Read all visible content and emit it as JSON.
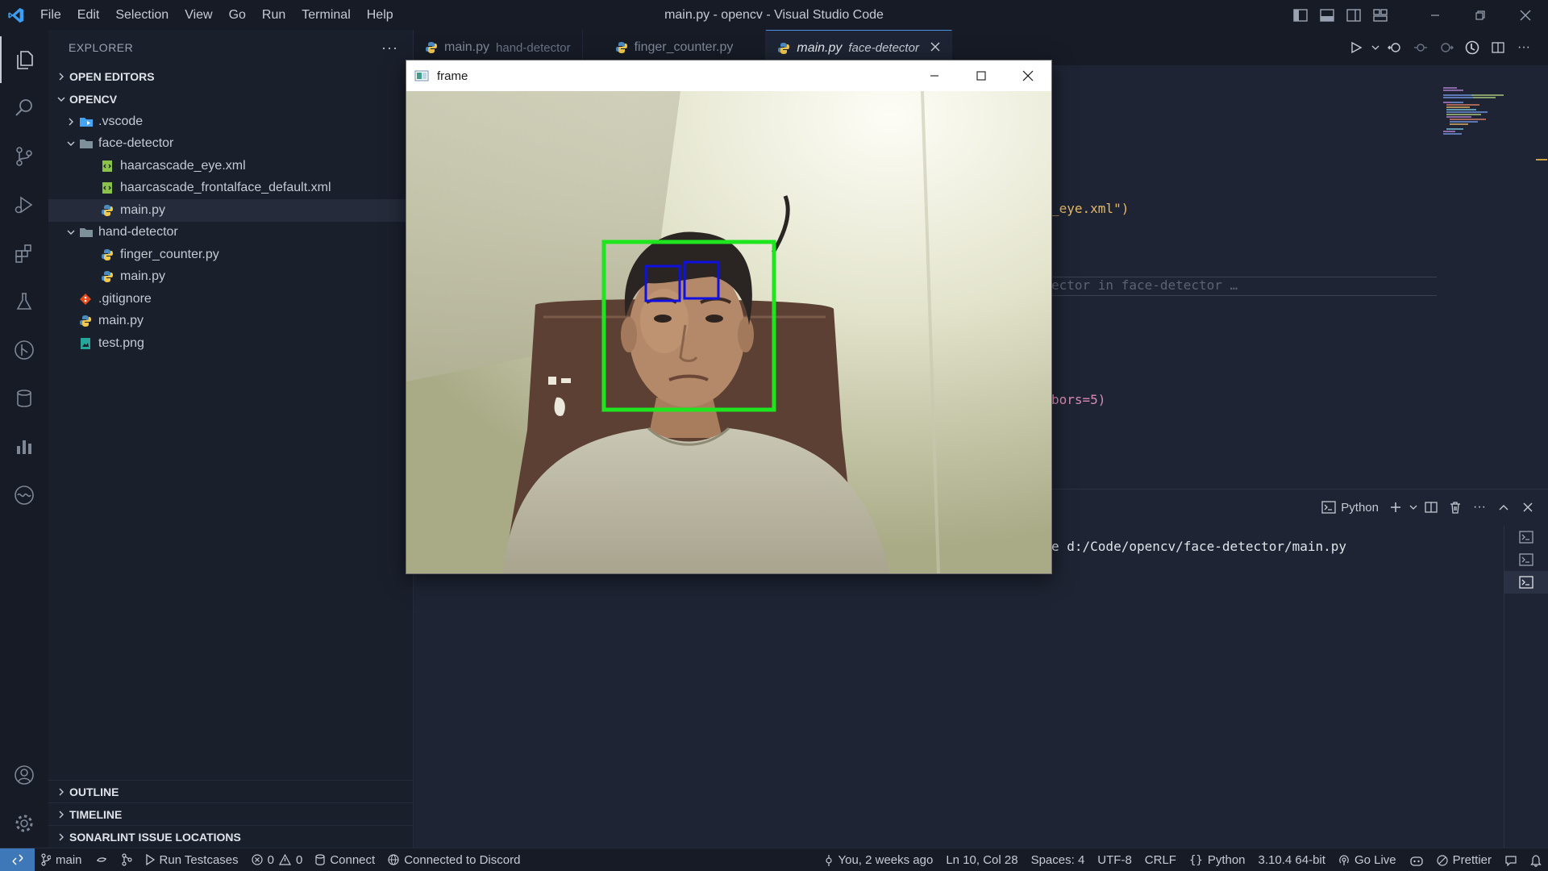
{
  "titlebar": {
    "menu": [
      "File",
      "Edit",
      "Selection",
      "View",
      "Go",
      "Run",
      "Terminal",
      "Help"
    ],
    "title": "main.py - opencv - Visual Studio Code"
  },
  "sidebar": {
    "header": "EXPLORER",
    "open_editors": "OPEN EDITORS",
    "workspace": "OPENCV",
    "tree": [
      {
        "label": ".vscode",
        "type": "folder",
        "depth": 1,
        "expanded": false
      },
      {
        "label": "face-detector",
        "type": "folder",
        "depth": 1,
        "expanded": true
      },
      {
        "label": "haarcascade_eye.xml",
        "type": "xml",
        "depth": 2
      },
      {
        "label": "haarcascade_frontalface_default.xml",
        "type": "xml",
        "depth": 2
      },
      {
        "label": "main.py",
        "type": "python",
        "depth": 2,
        "selected": true
      },
      {
        "label": "hand-detector",
        "type": "folder",
        "depth": 1,
        "expanded": true
      },
      {
        "label": "finger_counter.py",
        "type": "python",
        "depth": 2
      },
      {
        "label": "main.py",
        "type": "python",
        "depth": 2
      },
      {
        "label": ".gitignore",
        "type": "git",
        "depth": 1
      },
      {
        "label": "main.py",
        "type": "python",
        "depth": 1
      },
      {
        "label": "test.png",
        "type": "image",
        "depth": 1
      }
    ],
    "bottom_sections": [
      "OUTLINE",
      "TIMELINE",
      "SONARLINT ISSUE LOCATIONS"
    ]
  },
  "tabs": [
    {
      "label": "main.py",
      "desc": "hand-detector",
      "active": false
    },
    {
      "label": "finger_counter.py",
      "desc": "",
      "active": false
    },
    {
      "label": "main.py",
      "desc": "face-detector",
      "active": true
    }
  ],
  "editor": {
    "visible_fragments": [
      "_eye.xml\")",
      "ector in face-detector …",
      "bors=5)"
    ]
  },
  "panel": {
    "terminal_label": "Python",
    "terminal_line": "e d:/Code/opencv/face-detector/main.py"
  },
  "statusbar": {
    "branch": "main",
    "run_testcases": "Run Testcases",
    "errors": "0",
    "warnings": "0",
    "connect": "Connect",
    "discord": "Connected to Discord",
    "blame": "You, 2 weeks ago",
    "position": "Ln 10, Col 28",
    "spaces": "Spaces: 4",
    "encoding": "UTF-8",
    "eol": "CRLF",
    "language": "Python",
    "interpreter": "3.10.4 64-bit",
    "go_live": "Go Live",
    "prettier": "Prettier"
  },
  "cv_window": {
    "title": "frame"
  },
  "colors": {
    "accent": "#4a90e2",
    "face_box": "#1ee61e",
    "eye_box": "#1010e0"
  }
}
